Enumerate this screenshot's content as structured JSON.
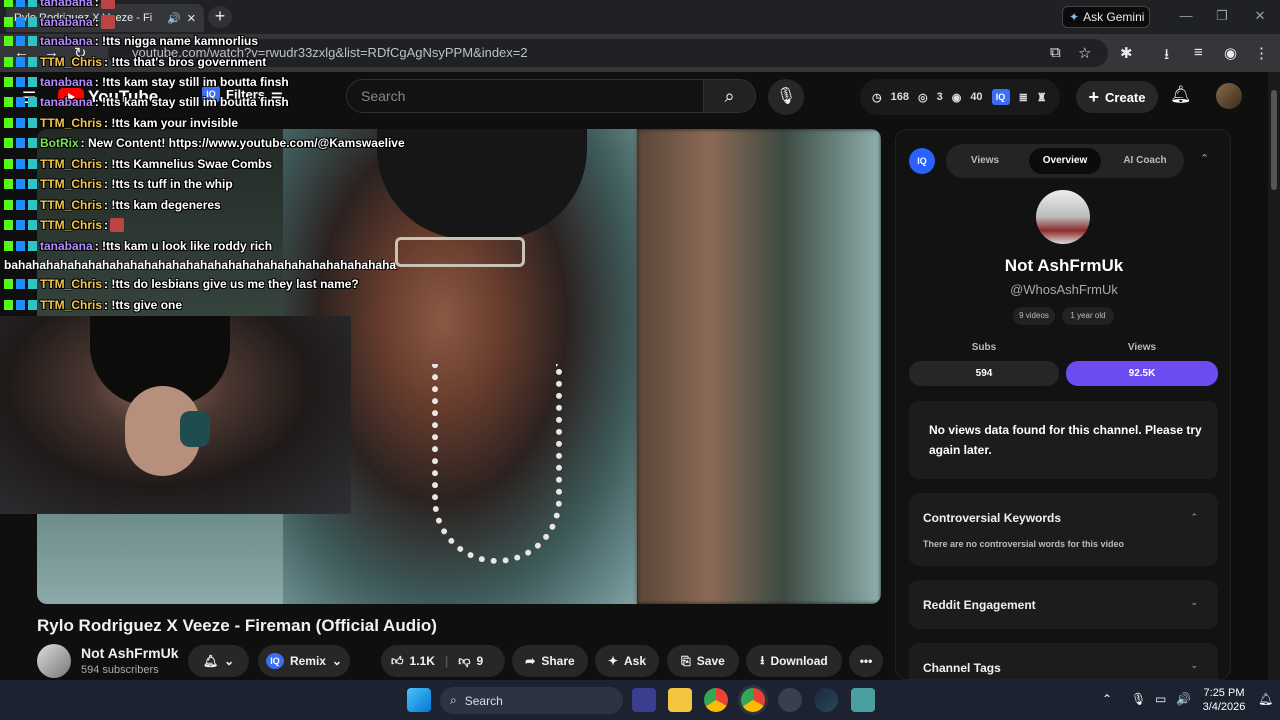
{
  "browser": {
    "tab_title": "Rylo Rodriguez X Veeze - Fi",
    "tab_audio_icon": "speaker-icon",
    "new_tab": "+",
    "ask_gemini": "Ask Gemini",
    "url": "youtube.com/watch?v=rwudr33zxlg&list=RDfCgAgNsyPPM&index=2"
  },
  "yt": {
    "logo": "YouTube",
    "filters": "Filters",
    "search_placeholder": "Search",
    "stats": {
      "clock": "168",
      "layers": "3",
      "views": "40"
    },
    "iq": "IQ",
    "create": "Create"
  },
  "chat": [
    {
      "user": "tanabana",
      "color": "purple",
      "msg": ":"
    },
    {
      "user": "tanabana",
      "color": "purple",
      "msg": ":"
    },
    {
      "user": "tanabana",
      "color": "purple",
      "msg": ": !tts nigga name kamnorlius"
    },
    {
      "user": "TTM_Chris",
      "color": "gold",
      "msg": ": !tts that's bros government"
    },
    {
      "user": "tanabana",
      "color": "purple",
      "msg": ": !tts kam stay still im boutta finsh"
    },
    {
      "user": "tanabana",
      "color": "purple",
      "msg": ": !tts kam stay still im boutta finsh"
    },
    {
      "user": "TTM_Chris",
      "color": "gold",
      "msg": ": !tts kam your invisible"
    },
    {
      "user": "BotRix",
      "color": "green",
      "msg": ": New Content! https://www.youtube.com/@Kamswaelive"
    },
    {
      "user": "TTM_Chris",
      "color": "gold",
      "msg": ": !tts Kamnelius Swae Combs"
    },
    {
      "user": "TTM_Chris",
      "color": "gold",
      "msg": ": !tts ts tuff in the whip"
    },
    {
      "user": "TTM_Chris",
      "color": "gold",
      "msg": ": !tts kam degeneres"
    },
    {
      "user": "TTM_Chris",
      "color": "gold",
      "msg": ":"
    },
    {
      "user": "tanabana",
      "color": "purple",
      "msg": ": !tts kam u look like roddy rich"
    },
    {
      "user": "TTM_Chris",
      "color": "gold",
      "msg": ": !tts do lesbians give us me they last name?"
    },
    {
      "user": "TTM_Chris",
      "color": "gold",
      "msg": ": !tts give one"
    }
  ],
  "chat_continuation": "bahahahahahahahahahahahahahahahahahahahahahahahahahahaha",
  "video": {
    "title": "Rylo Rodriguez X Veeze - Fireman (Official Audio)",
    "channel": "Not AshFrmUk",
    "subscribers": "594 subscribers",
    "remix": "Remix",
    "likes": "1.1K",
    "dislikes": "9",
    "share": "Share",
    "ask": "Ask",
    "save": "Save",
    "download": "Download",
    "more": "•••"
  },
  "panel": {
    "iq": "IQ",
    "tabs": [
      "Views",
      "Overview",
      "AI Coach"
    ],
    "active_tab": "Overview",
    "channel_name": "Not AshFrmUk",
    "handle": "@WhosAshFrmUk",
    "chips": [
      "9 videos",
      "1 year old"
    ],
    "subs_label": "Subs",
    "views_label": "Views",
    "subs_value": "594",
    "views_value": "92.5K",
    "no_data": "No views data found for this channel. Please try again later.",
    "controversial_title": "Controversial Keywords",
    "controversial_body": "There are no controversial words for this video",
    "reddit_title": "Reddit Engagement",
    "tags_title": "Channel Tags",
    "accent": "#6c4cf1"
  },
  "taskbar": {
    "search": "Search",
    "time": "7:25 PM",
    "date": "3/4/2026"
  }
}
